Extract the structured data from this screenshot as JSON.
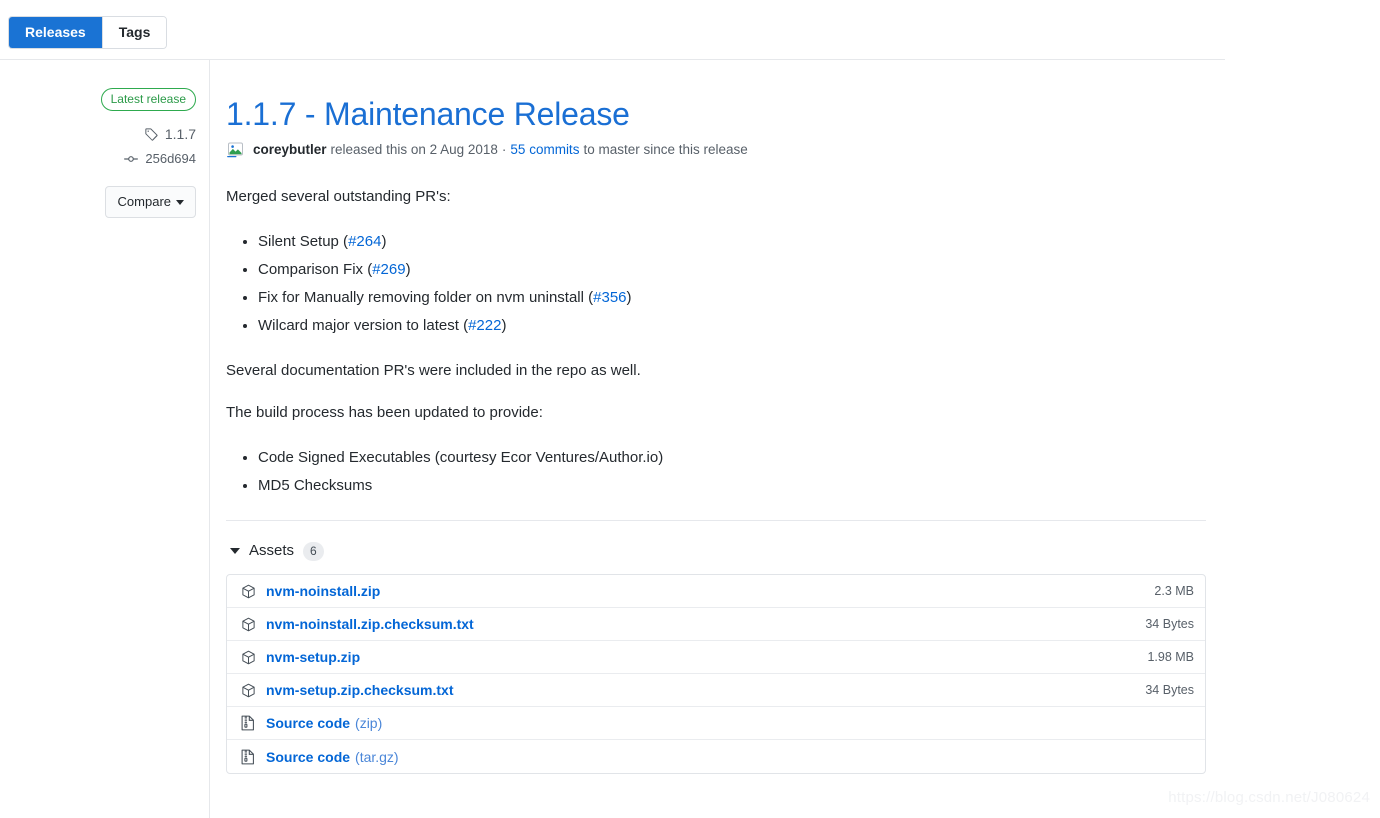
{
  "tabs": {
    "releases_label": "Releases",
    "tags_label": "Tags",
    "active": "Releases"
  },
  "sidebar": {
    "latest_badge": "Latest release",
    "tag_name": "1.1.7",
    "commit_sha": "256d694",
    "compare_label": "Compare",
    "icons": {
      "tag": "tag-icon",
      "commit": "commit-icon",
      "caret": "caret-down-icon"
    }
  },
  "release": {
    "title": "1.1.7 - Maintenance Release",
    "author": "coreybutler",
    "released_text": "released this on 2 Aug 2018",
    "separator": "·",
    "commits_link": "55 commits",
    "commits_suffix": "to master since this release",
    "avatar_name": "broken-image-avatar-icon"
  },
  "body": {
    "intro": "Merged several outstanding PR's:",
    "pr_items": [
      {
        "text": "Silent Setup (",
        "link": "#264",
        "close": ")"
      },
      {
        "text": "Comparison Fix (",
        "link": "#269",
        "close": ")"
      },
      {
        "text": "Fix for Manually removing folder on nvm uninstall (",
        "link": "#356",
        "close": ")"
      },
      {
        "text": "Wilcard major version to latest (",
        "link": "#222",
        "close": ")"
      }
    ],
    "docs_note": "Several documentation PR's were included in the repo as well.",
    "build_note": "The build process has been updated to provide:",
    "build_items": [
      "Code Signed Executables (courtesy Ecor Ventures/Author.io)",
      "MD5 Checksums"
    ]
  },
  "assets": {
    "label": "Assets",
    "count": "6",
    "rows": [
      {
        "name": "nvm-noinstall.zip",
        "format": "",
        "size": "2.3 MB",
        "icon": "package-icon"
      },
      {
        "name": "nvm-noinstall.zip.checksum.txt",
        "format": "",
        "size": "34 Bytes",
        "icon": "package-icon"
      },
      {
        "name": "nvm-setup.zip",
        "format": "",
        "size": "1.98 MB",
        "icon": "package-icon"
      },
      {
        "name": "nvm-setup.zip.checksum.txt",
        "format": "",
        "size": "34 Bytes",
        "icon": "package-icon"
      },
      {
        "name": "Source code",
        "format": "(zip)",
        "size": "",
        "icon": "file-zip-icon"
      },
      {
        "name": "Source code",
        "format": "(tar.gz)",
        "size": "",
        "icon": "file-zip-icon"
      }
    ]
  },
  "watermark": {
    "text": "https://blog.csdn.net/J080624"
  },
  "colors": {
    "link_blue": "#0366d6",
    "title_blue": "#1a6fd4",
    "active_tab_blue": "#1a73d4",
    "badge_green": "#2eaa4e",
    "muted_gray": "#586069"
  }
}
